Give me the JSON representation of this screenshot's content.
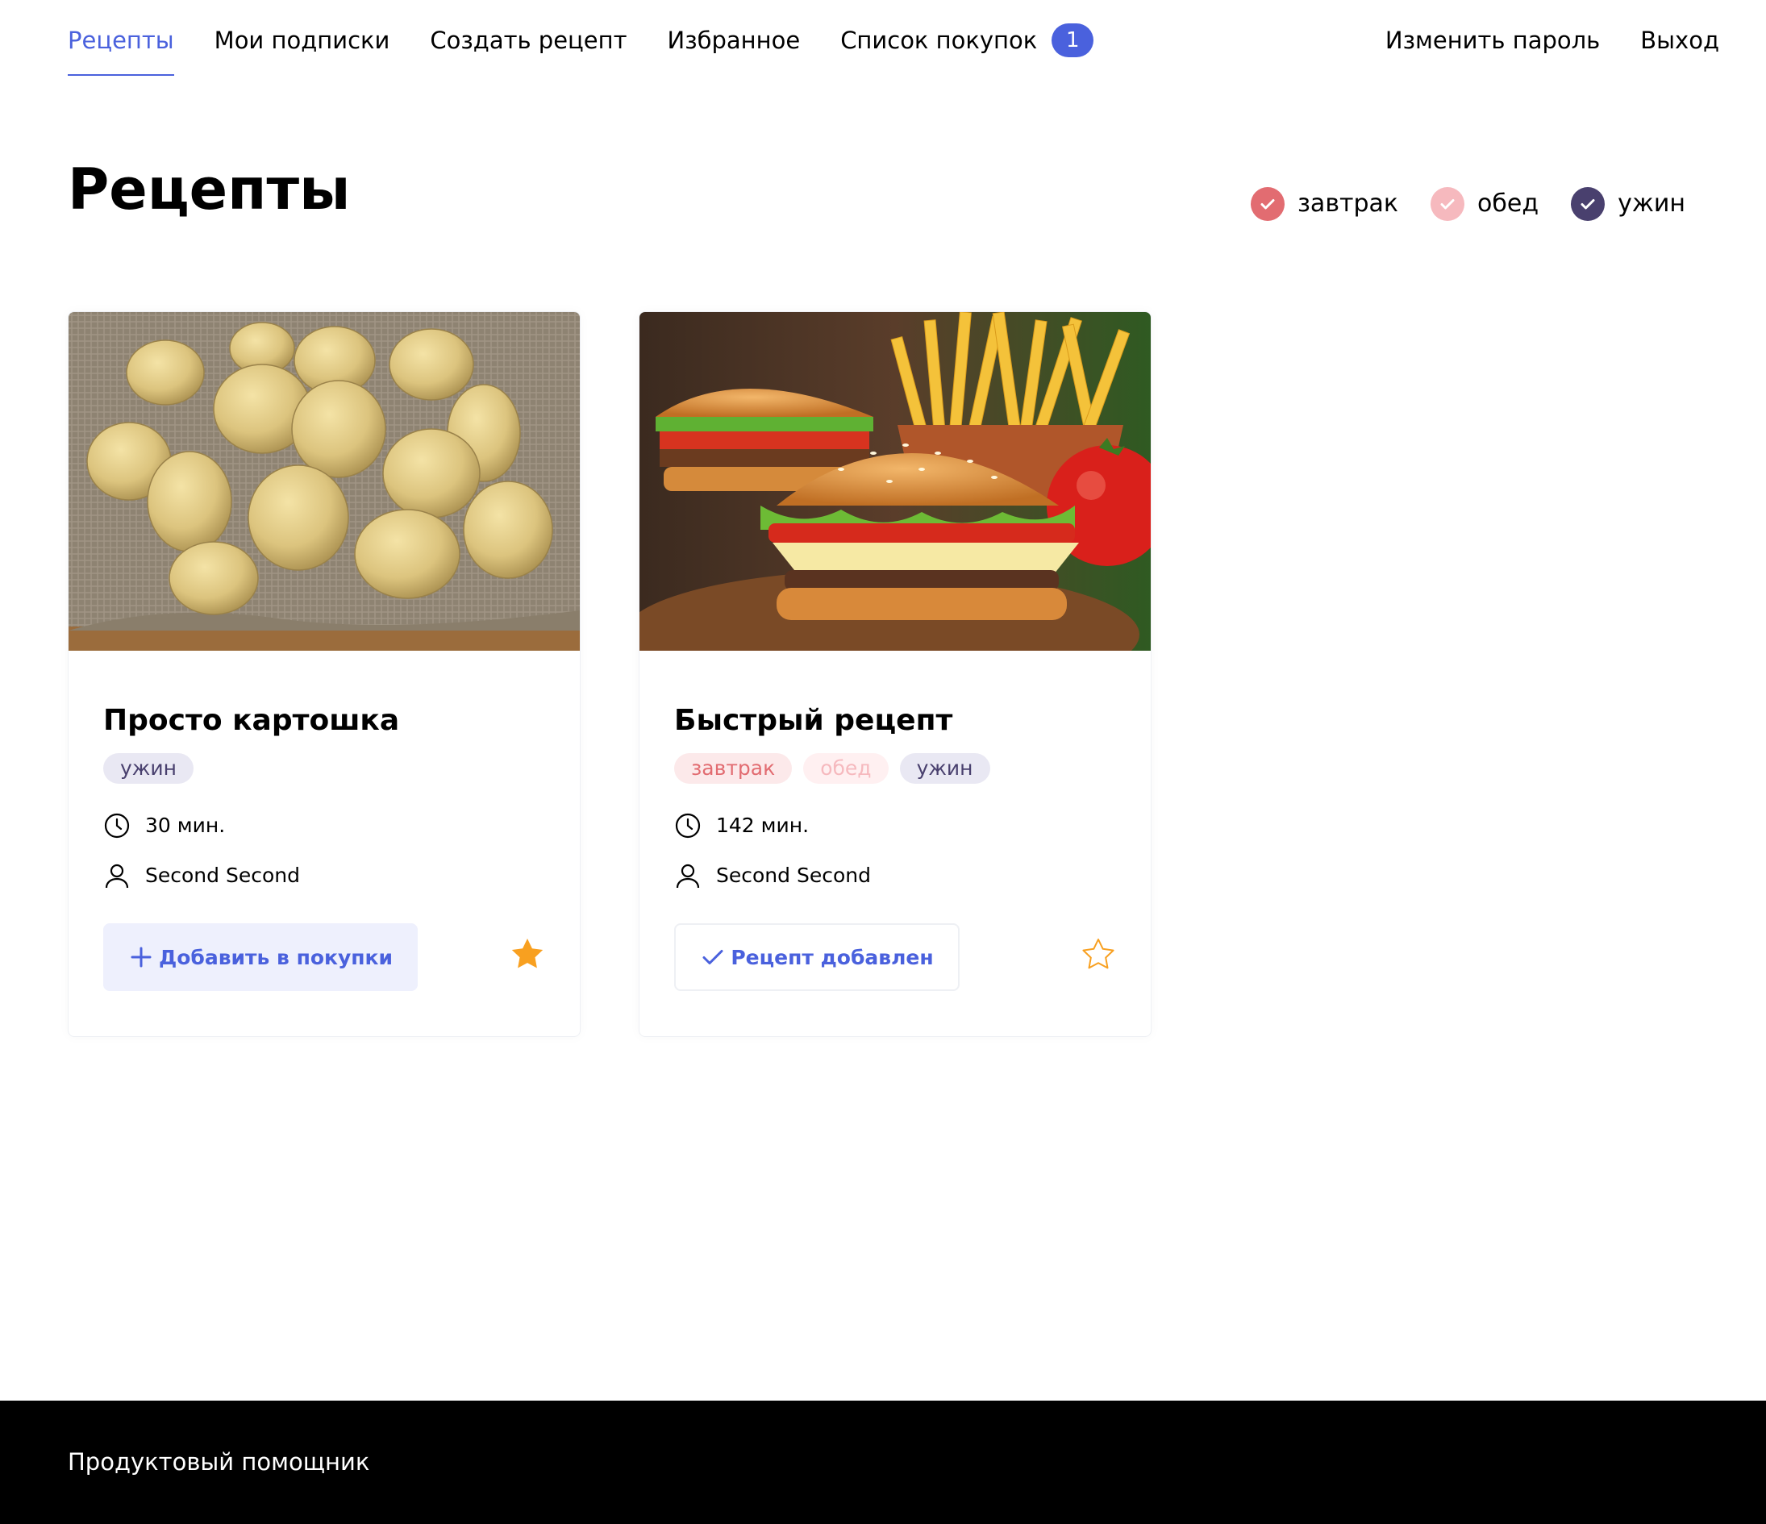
{
  "nav": {
    "left": [
      {
        "label": "Рецепты",
        "active": true
      },
      {
        "label": "Мои подписки"
      },
      {
        "label": "Создать рецепт"
      },
      {
        "label": "Избранное"
      },
      {
        "label": "Список покупок",
        "badge": "1"
      }
    ],
    "right": [
      {
        "label": "Изменить пароль"
      },
      {
        "label": "Выход"
      }
    ]
  },
  "page": {
    "title": "Рецепты"
  },
  "filters": [
    {
      "label": "завтрак",
      "color": "#E26C71",
      "checked": true
    },
    {
      "label": "обед",
      "color": "#F6B9BE",
      "checked": true
    },
    {
      "label": "ужин",
      "color": "#49406E",
      "checked": true
    }
  ],
  "recipes": [
    {
      "title": "Просто картошка",
      "image": "potatoes-photo",
      "tags": [
        {
          "label": "ужин",
          "kind": "dinner"
        }
      ],
      "time": "30 мин.",
      "author": "Second Second",
      "button_label": "Добавить в покупки",
      "button_icon": "plus-icon",
      "favorite": true
    },
    {
      "title": "Быстрый рецепт",
      "image": "burger-photo",
      "tags": [
        {
          "label": "завтрак",
          "kind": "breakfast"
        },
        {
          "label": "обед",
          "kind": "lunch"
        },
        {
          "label": "ужин",
          "kind": "dinner"
        }
      ],
      "time": "142 мин.",
      "author": "Second Second",
      "button_label": "Рецепт добавлен",
      "button_icon": "checkmark-icon",
      "favorite": false
    }
  ],
  "footer": {
    "text": "Продуктовый помощник"
  },
  "colors": {
    "accent": "#4A61DD",
    "favorite": "#F8A020",
    "footer_bg": "#000000"
  }
}
